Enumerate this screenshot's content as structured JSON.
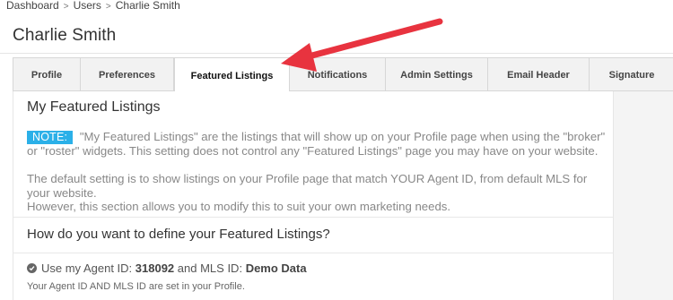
{
  "breadcrumb": {
    "items": [
      "Dashboard",
      "Users",
      "Charlie Smith"
    ],
    "separator": ">"
  },
  "page": {
    "title": "Charlie Smith"
  },
  "tabs": [
    {
      "label": "Profile",
      "active": false
    },
    {
      "label": "Preferences",
      "active": false
    },
    {
      "label": "Featured Listings",
      "active": true
    },
    {
      "label": "Notifications",
      "active": false
    },
    {
      "label": "Admin Settings",
      "active": false
    },
    {
      "label": "Email Header",
      "active": false
    },
    {
      "label": "Signature",
      "active": false
    }
  ],
  "content": {
    "section_title": "My Featured Listings",
    "note_badge": "NOTE:",
    "note_text": "\"My Featured Listings\" are the listings that will show up on your Profile page when using the \"broker\" or \"roster\" widgets. This setting does not control any \"Featured Listings\" page you may have on your website.",
    "default_text_1": "The default setting is to show listings on your Profile page that match YOUR Agent ID, from default MLS for your website.",
    "default_text_2": "However, this section allows you to modify this to suit your own marketing needs.",
    "question": "How do you want to define your Featured Listings?",
    "option": {
      "prefix": "Use my Agent ID:",
      "agent_id": "318092",
      "middle": "and MLS ID:",
      "mls_id": "Demo Data",
      "note": "Your Agent ID AND MLS ID are set in your Profile."
    }
  },
  "colors": {
    "note_badge": "#2bb0e8",
    "arrow": "#e8333f"
  },
  "icons": {
    "option_check": "check-circle-icon",
    "breadcrumb_separator": "chevron-right-icon",
    "annotation": "arrow-icon"
  }
}
